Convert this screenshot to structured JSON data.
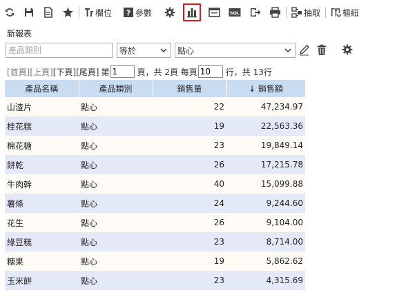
{
  "toolbar": {
    "fields_label": "欄位",
    "params_label": "參數",
    "extract_label": "抽取",
    "pivot_label": "樞紐",
    "sql_label": "SQL"
  },
  "report_title": "新報表",
  "filter": {
    "field_placeholder": "產品類別",
    "operator": "等於",
    "value": "點心"
  },
  "pager": {
    "first": "[首頁]",
    "prev": "[上頁]",
    "next": "[下頁]",
    "last": "[尾頁]",
    "page_prefix": "第",
    "page_value": "1",
    "page_mid": "頁，共 2頁 每頁",
    "per_page_value": "10",
    "per_page_suffix": "行，共 13行"
  },
  "table": {
    "columns": [
      "產品名稱",
      "產品類別",
      "銷售量",
      "↓ 銷售額"
    ],
    "rows": [
      [
        "山渣片",
        "點心",
        "22",
        "47,234.97"
      ],
      [
        "桂花糕",
        "點心",
        "19",
        "22,563.36"
      ],
      [
        "棉花糖",
        "點心",
        "23",
        "19,849.14"
      ],
      [
        "餅乾",
        "點心",
        "26",
        "17,215.78"
      ],
      [
        "牛肉幹",
        "點心",
        "40",
        "15,099.88"
      ],
      [
        "薯條",
        "點心",
        "24",
        "9,244.60"
      ],
      [
        "花生",
        "點心",
        "26",
        "9,104.00"
      ],
      [
        "綠豆糕",
        "點心",
        "23",
        "8,714.00"
      ],
      [
        "糖果",
        "點心",
        "19",
        "5,862.62"
      ],
      [
        "玉米餅",
        "點心",
        "23",
        "4,315.69"
      ]
    ]
  },
  "colors": {
    "header_bg": "#c9ddf2",
    "row_odd": "#fdfbf4",
    "row_even": "#e4e9f8",
    "active_outline": "#e0161b"
  }
}
